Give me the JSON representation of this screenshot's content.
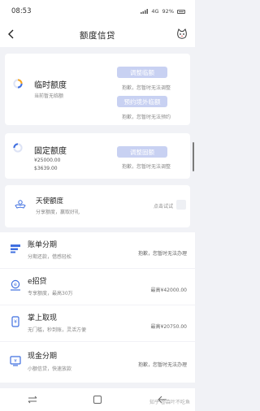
{
  "status_bar": {
    "time": "08:53",
    "signal_text": "4G",
    "battery": "92%"
  },
  "nav": {
    "title": "额度信贷",
    "back_icon": "back-arrow-icon",
    "bot_icon": "cat-bot-icon"
  },
  "temp_limit": {
    "title": "临时额度",
    "subtitle": "当前暂无临额",
    "apply_button": "调整临额",
    "apply_hint": "抱歉，您暂时无法调整",
    "overseas_button": "预约境外临额",
    "overseas_hint": "抱歉，您暂时无法预约"
  },
  "fixed_limit": {
    "title": "固定额度",
    "amount_total": "¥25000.00",
    "amount_available": "$3639.00",
    "adjust_button": "调整固额",
    "adjust_hint": "抱歉，您暂时无法调整"
  },
  "angel_limit": {
    "title": "天使额度",
    "subtitle": "分享额度，赢取好礼",
    "action": "点击试试"
  },
  "products": [
    {
      "title": "账单分期",
      "subtitle": "分期还款，借感轻松",
      "right": "抱歉，您暂时无法办理",
      "icon": "bill-installment-icon"
    },
    {
      "title": "e招贷",
      "subtitle": "专享额度，最高30万",
      "right": "最高¥42000.00",
      "icon": "e-loan-icon"
    },
    {
      "title": "掌上取现",
      "subtitle": "无门槛，秒到账，灵活方便",
      "right": "最高¥20750.00",
      "icon": "cash-withdraw-icon"
    },
    {
      "title": "现金分期",
      "subtitle": "小额信贷，快速放款",
      "right": "抱歉，您暂时无法办理",
      "icon": "cash-installment-icon"
    }
  ],
  "watermark": "知乎 @森叶不吃鱼",
  "colors": {
    "primary_blue": "#3f6fe0",
    "disabled_button": "#c8d1f2",
    "background": "#f1f2f6"
  }
}
